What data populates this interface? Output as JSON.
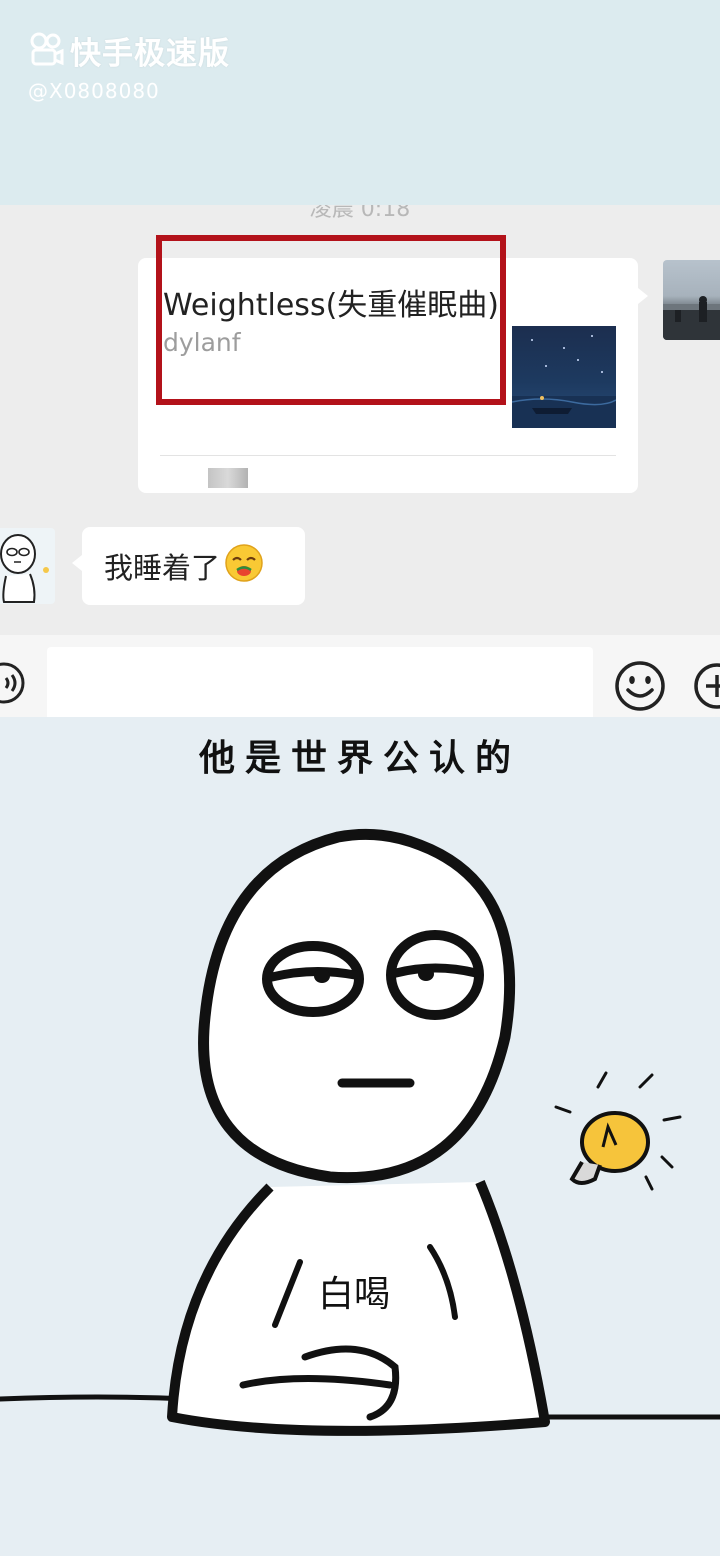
{
  "watermark": {
    "app_name": "快手极速版",
    "user_handle": "@X0808080",
    "logo_icon": "kuaishou-logo-icon"
  },
  "chat": {
    "timestamp": "凌晨 0:18",
    "music_card": {
      "title": "Weightless(失重催眠曲)",
      "artist": "dylanf",
      "cover_icon": "album-cover-night-sky"
    },
    "message": {
      "text": "我睡着了",
      "emoji": "😴"
    }
  },
  "input_bar": {
    "voice_icon": "voice-icon",
    "emoji_icon": "emoji-smile-icon",
    "plus_icon": "plus-icon"
  },
  "meme": {
    "caption": "他是世界公认的",
    "shirt_text": "白喝",
    "bulb_icon": "lightbulb-icon"
  },
  "colors": {
    "highlight_border": "#b3121a",
    "chat_background": "#ededed",
    "meme_background": "#e6eef3"
  }
}
